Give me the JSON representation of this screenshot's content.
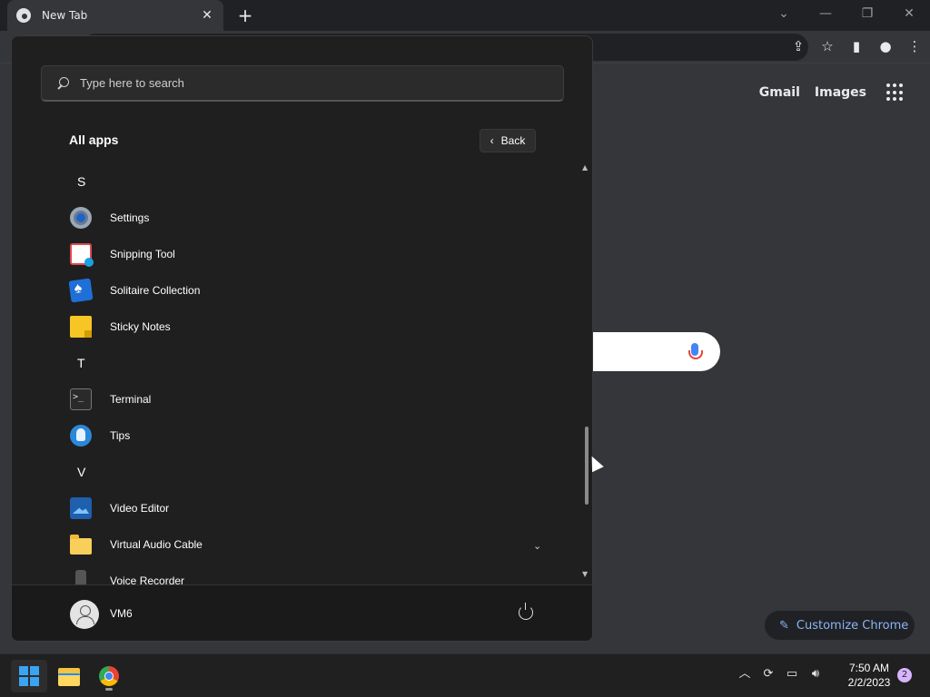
{
  "browser": {
    "tab_title": "New Tab",
    "tab_close": "✕",
    "new_tab": "+",
    "links": {
      "gmail": "Gmail",
      "images": "Images"
    },
    "customize_label": "Customize Chrome"
  },
  "start_menu": {
    "search_placeholder": "Type here to search",
    "all_apps_title": "All apps",
    "back_label": "Back",
    "sections": [
      {
        "letter": "S",
        "apps": [
          "Settings",
          "Snipping Tool",
          "Solitaire Collection",
          "Sticky Notes"
        ]
      },
      {
        "letter": "T",
        "apps": [
          "Terminal",
          "Tips"
        ]
      },
      {
        "letter": "V",
        "apps": [
          "Video Editor",
          "Virtual Audio Cable",
          "Voice Recorder"
        ]
      }
    ],
    "user_name": "VM6"
  },
  "taskbar": {
    "time": "7:50 AM",
    "date": "2/2/2023",
    "notification_count": "2"
  },
  "colors": {
    "accent_blue": "#3aa4f2",
    "chrome_link": "#8ab4f8",
    "menu_bg": "#1f1f1f"
  }
}
